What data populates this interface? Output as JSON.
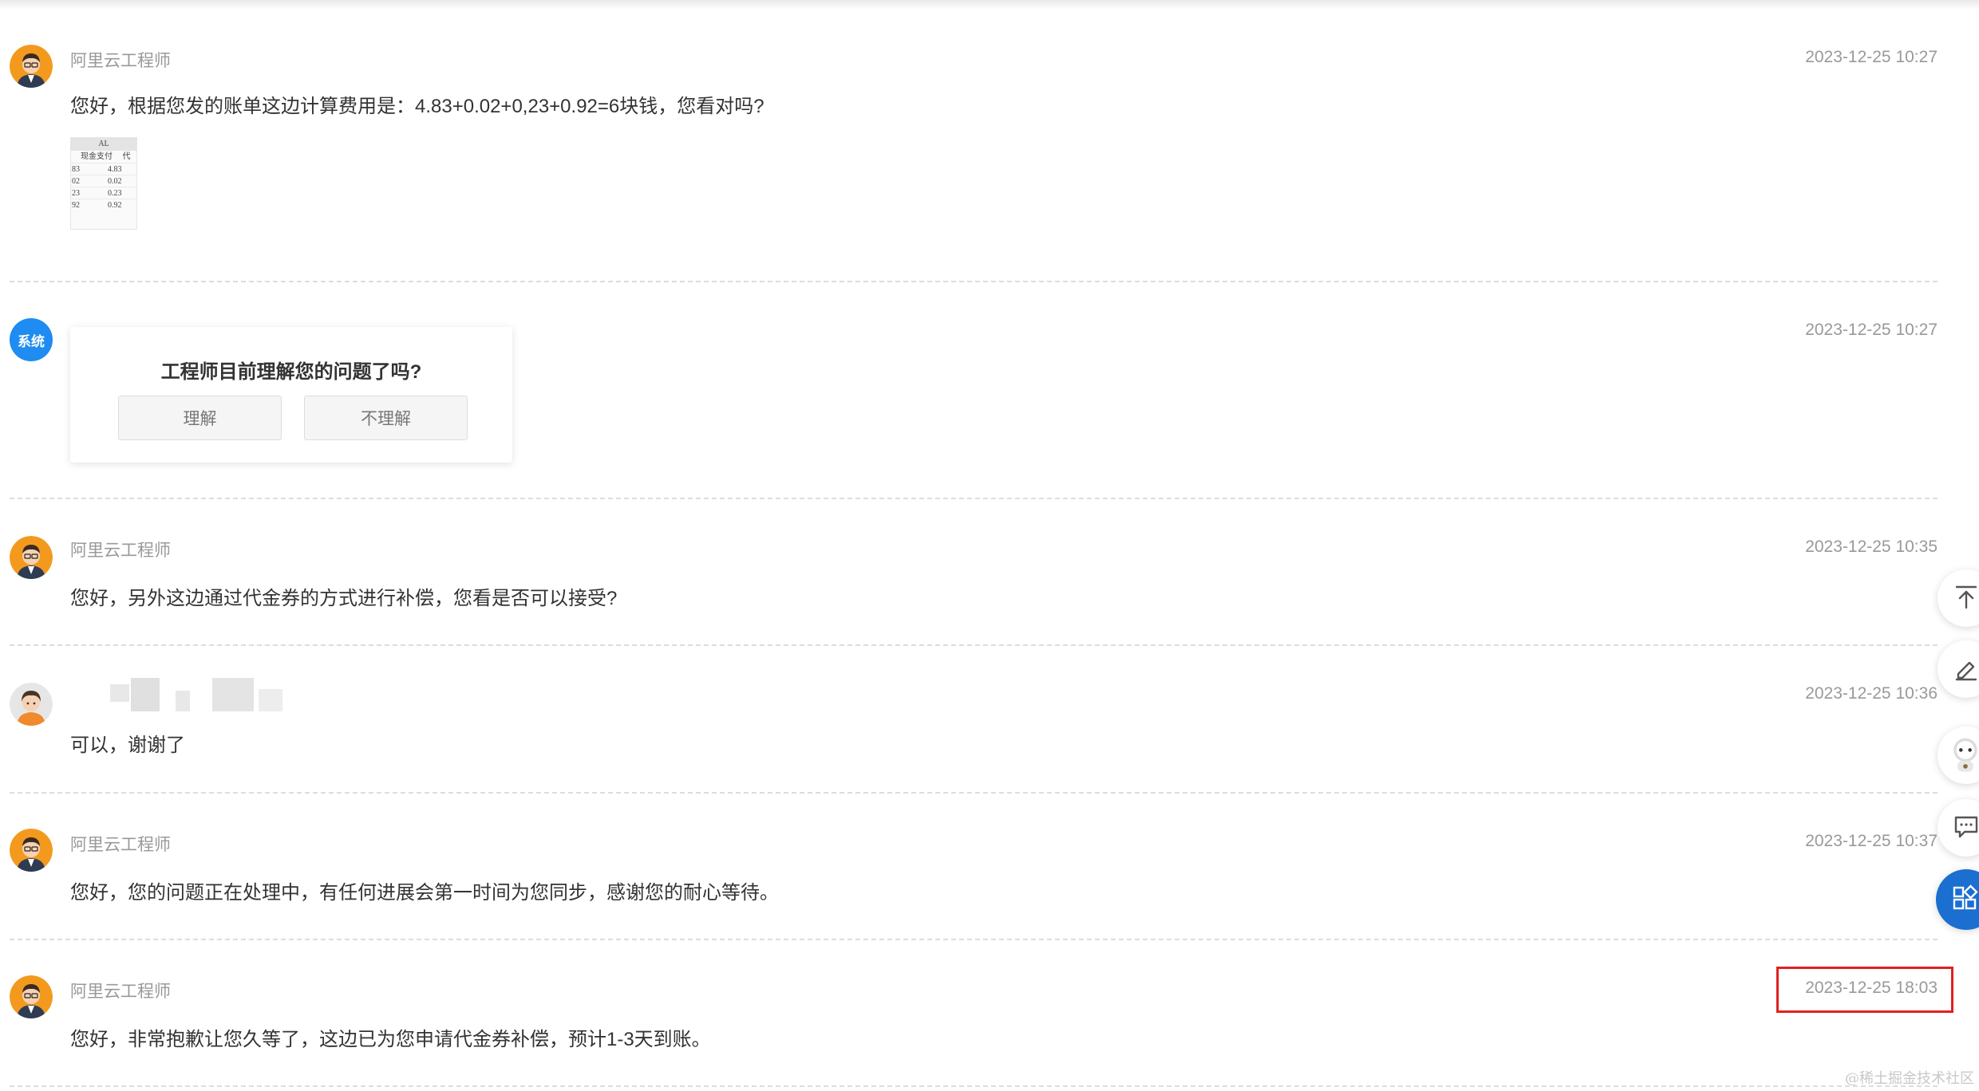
{
  "messages": [
    {
      "sender": "阿里云工程师",
      "time": "2023-12-25 10:27",
      "text": "您好，根据您发的账单这边计算费用是：4.83+0.02+0,23+0.92=6块钱，您看对吗?",
      "attachment": {
        "header": "AL",
        "subheader": "现金支付",
        "subheader_extra": "代",
        "rows": [
          {
            "a": "83",
            "b": "4.83"
          },
          {
            "a": "02",
            "b": "0.02"
          },
          {
            "a": "23",
            "b": "0.23"
          },
          {
            "a": "92",
            "b": "0.92"
          }
        ]
      }
    },
    {
      "sender_badge": "系统",
      "time": "2023-12-25 10:27",
      "survey": {
        "question": "工程师目前理解您的问题了吗?",
        "option_yes": "理解",
        "option_no": "不理解"
      }
    },
    {
      "sender": "阿里云工程师",
      "time": "2023-12-25 10:35",
      "text": "您好，另外这边通过代金券的方式进行补偿，您看是否可以接受?"
    },
    {
      "time": "2023-12-25 10:36",
      "text": "可以，谢谢了"
    },
    {
      "sender": "阿里云工程师",
      "time": "2023-12-25 10:37",
      "text": "您好，您的问题正在处理中，有任何进展会第一时间为您同步，感谢您的耐心等待。"
    },
    {
      "sender": "阿里云工程师",
      "time": "2023-12-25 18:03",
      "text": "您好，非常抱歉让您久等了，这边已为您申请代金券补偿，预计1-3天到账。"
    }
  ],
  "float_tools": [
    "back-to-top-icon",
    "edit-icon",
    "robot-assistant-icon",
    "chat-icon",
    "apps-grid-icon"
  ],
  "watermark": "@稀土掘金技术社区",
  "colors": {
    "system_badge": "#1e8cf0",
    "highlight": "#e02020",
    "primary_float": "#1a6fd0"
  }
}
